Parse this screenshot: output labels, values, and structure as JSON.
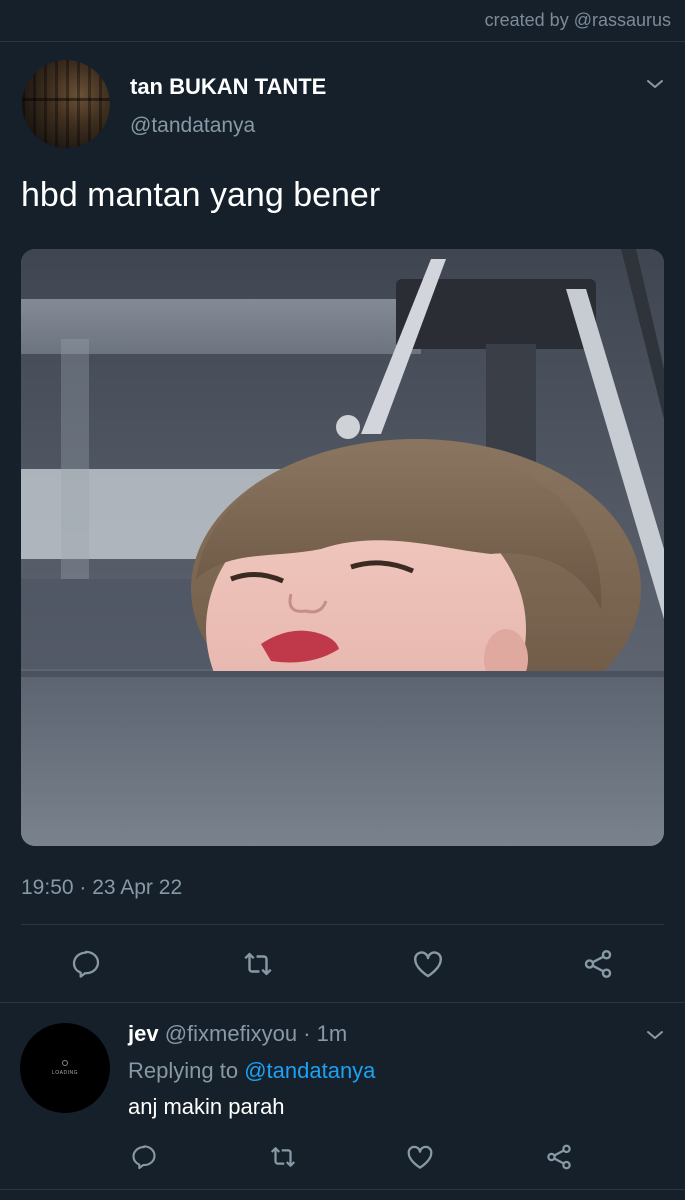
{
  "credit": "created by @rassaurus",
  "tweet": {
    "display_name": "tan BUKAN TANTE",
    "handle": "@tandatanya",
    "text": "hbd mantan yang bener",
    "timestamp": "19:50 · 23 Apr 22"
  },
  "actions": {
    "reply_icon": "reply-icon",
    "retweet_icon": "retweet-icon",
    "like_icon": "heart-icon",
    "share_icon": "share-icon"
  },
  "reply": {
    "name": "jev",
    "handle": "@fixmefixyou",
    "separator": "·",
    "time": "1m",
    "replying_prefix": "Replying to",
    "replying_to": "@tandatanya",
    "text": "anj makin parah",
    "avatar_text": "LOADING"
  },
  "colors": {
    "background": "#15202b",
    "secondary_text": "#8899a6",
    "link": "#1da1f2",
    "divider": "#2a3540"
  }
}
